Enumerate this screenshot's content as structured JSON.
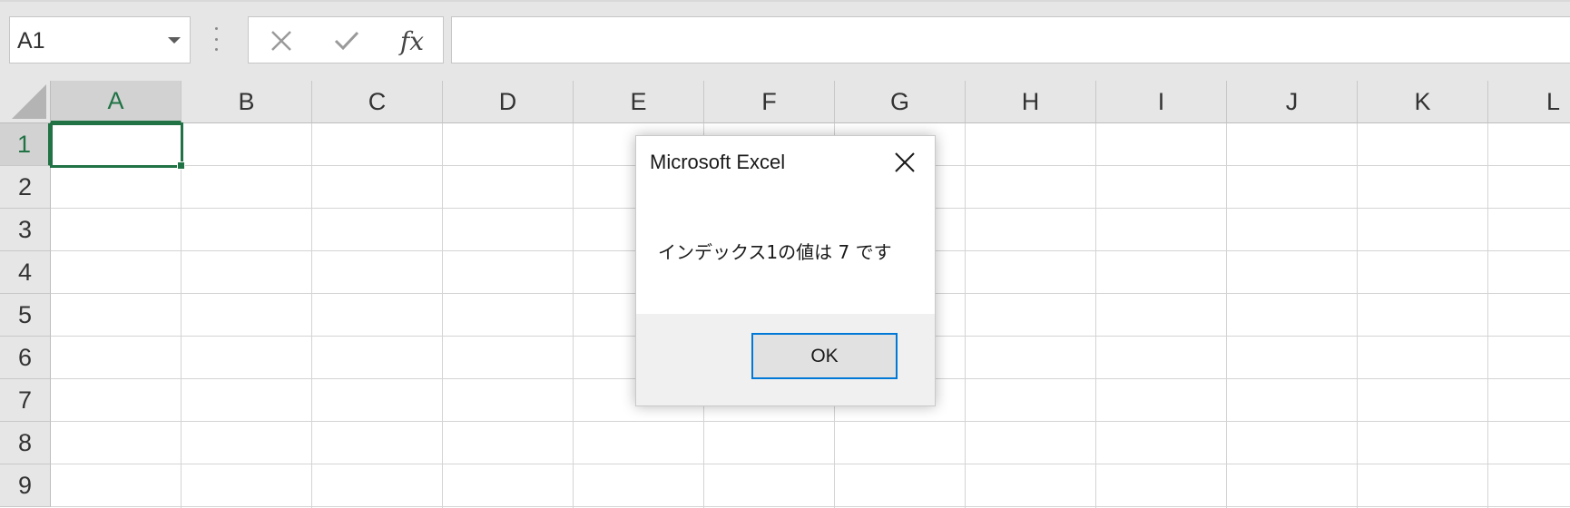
{
  "formula_bar": {
    "name_box_value": "A1",
    "insert_function_label": "fx",
    "formula_value": ""
  },
  "sheet": {
    "columns": [
      "A",
      "B",
      "C",
      "D",
      "E",
      "F",
      "G",
      "H",
      "I",
      "J",
      "K",
      "L"
    ],
    "rows": [
      "1",
      "2",
      "3",
      "4",
      "5",
      "6",
      "7",
      "8",
      "9"
    ],
    "active_column": "A",
    "active_row": "1"
  },
  "dialog": {
    "title": "Microsoft Excel",
    "message": "インデックス1の値は 7 です",
    "ok_label": "OK"
  },
  "colors": {
    "accent_green": "#217346",
    "button_focus_blue": "#0078d7"
  }
}
